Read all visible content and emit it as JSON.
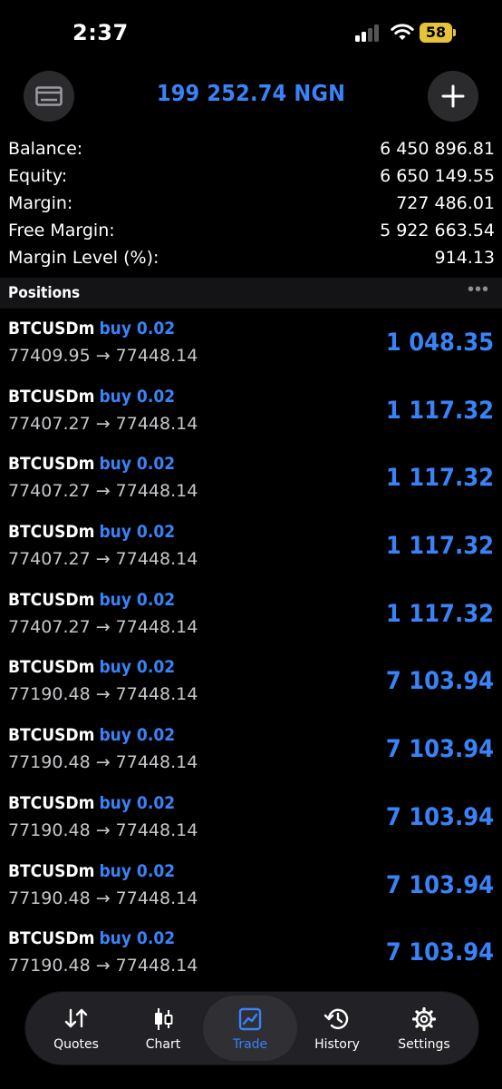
{
  "status": {
    "time": "2:37",
    "battery": "58"
  },
  "header": {
    "title": "199 252.74 NGN"
  },
  "account": [
    {
      "label": "Balance:",
      "value": "6 450 896.81"
    },
    {
      "label": "Equity:",
      "value": "6 650 149.55"
    },
    {
      "label": "Margin:",
      "value": "727 486.01"
    },
    {
      "label": "Free Margin:",
      "value": "5 922 663.54"
    },
    {
      "label": "Margin Level (%):",
      "value": "914.13"
    }
  ],
  "positions_header": {
    "title": "Positions",
    "more": "•••"
  },
  "positions": [
    {
      "symbol": "BTCUSDm",
      "side": "buy 0.02",
      "prices": "77409.95 → 77448.14",
      "profit": "1 048.35"
    },
    {
      "symbol": "BTCUSDm",
      "side": "buy 0.02",
      "prices": "77407.27 → 77448.14",
      "profit": "1 117.32"
    },
    {
      "symbol": "BTCUSDm",
      "side": "buy 0.02",
      "prices": "77407.27 → 77448.14",
      "profit": "1 117.32"
    },
    {
      "symbol": "BTCUSDm",
      "side": "buy 0.02",
      "prices": "77407.27 → 77448.14",
      "profit": "1 117.32"
    },
    {
      "symbol": "BTCUSDm",
      "side": "buy 0.02",
      "prices": "77407.27 → 77448.14",
      "profit": "1 117.32"
    },
    {
      "symbol": "BTCUSDm",
      "side": "buy 0.02",
      "prices": "77190.48 → 77448.14",
      "profit": "7 103.94"
    },
    {
      "symbol": "BTCUSDm",
      "side": "buy 0.02",
      "prices": "77190.48 → 77448.14",
      "profit": "7 103.94"
    },
    {
      "symbol": "BTCUSDm",
      "side": "buy 0.02",
      "prices": "77190.48 → 77448.14",
      "profit": "7 103.94"
    },
    {
      "symbol": "BTCUSDm",
      "side": "buy 0.02",
      "prices": "77190.48 → 77448.14",
      "profit": "7 103.94"
    },
    {
      "symbol": "BTCUSDm",
      "side": "buy 0.02",
      "prices": "77190.48 → 77448.14",
      "profit": "7 103.94"
    }
  ],
  "tabs": [
    {
      "label": "Quotes",
      "icon": "sort-arrows-icon"
    },
    {
      "label": "Chart",
      "icon": "candlestick-icon"
    },
    {
      "label": "Trade",
      "icon": "trade-chart-icon",
      "active": true
    },
    {
      "label": "History",
      "icon": "history-clock-icon"
    },
    {
      "label": "Settings",
      "icon": "gear-icon"
    }
  ],
  "colors": {
    "accent": "#3a82f7",
    "background": "#000000",
    "battery": "#e8c33a"
  }
}
